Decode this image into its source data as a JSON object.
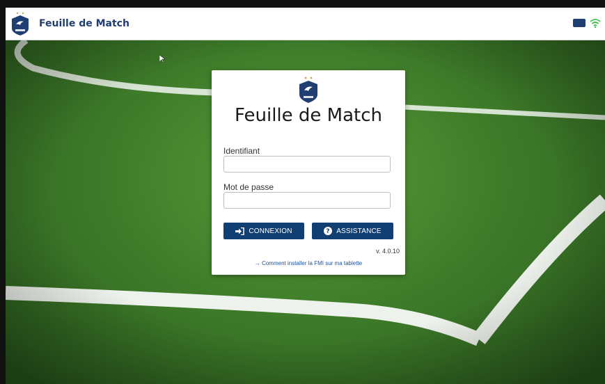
{
  "header": {
    "title": "Feuille de Match",
    "logo_icon": "fff-logo-icon",
    "status_icons": [
      "battery-icon",
      "wifi-icon"
    ]
  },
  "login": {
    "title": "Feuille de Match",
    "logo_icon": "fff-logo-icon",
    "username_label": "Identifiant",
    "username_value": "",
    "password_label": "Mot de passe",
    "password_value": "",
    "connect_label": "CONNEXION",
    "connect_icon": "sign-in-icon",
    "assist_label": "ASSISTANCE",
    "assist_icon": "question-circle-icon",
    "version": "v. 4.0.10",
    "help_link": "→ Comment installer la FMI sur ma tablette"
  },
  "colors": {
    "brand_blue": "#123f73",
    "header_text": "#1f3f73",
    "wifi_green": "#3fbf4f"
  }
}
